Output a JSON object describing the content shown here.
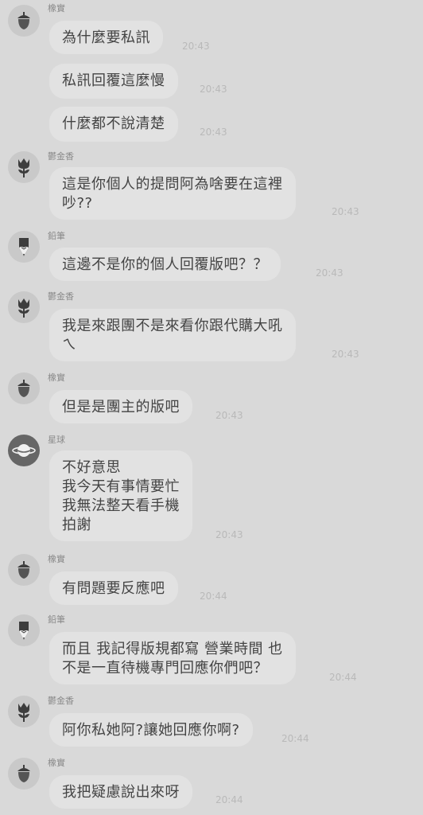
{
  "messages": [
    {
      "sender": "橡實",
      "text": "為什麼要私訊",
      "time": "20:43"
    },
    {
      "text": "私訊回覆這麼慢",
      "time": "20:43"
    },
    {
      "text": "什麼都不說清楚",
      "time": "20:43"
    },
    {
      "sender": "鬱金香",
      "text": "這是你個人的提問阿為啥要在這裡\n吵??",
      "time": "20:43"
    },
    {
      "sender": "鉛筆",
      "text": "這邊不是你的個人回覆版吧？？",
      "time": "20:43"
    },
    {
      "sender": "鬱金香",
      "text": "我是來跟團不是來看你跟代購大吼\nㄟ",
      "time": "20:43"
    },
    {
      "sender": "橡實",
      "text": "但是是團主的版吧",
      "time": "20:43"
    },
    {
      "sender": "星球",
      "text": "不好意思\n我今天有事情要忙\n我無法整天看手機\n拍謝",
      "time": "20:43"
    },
    {
      "sender": "橡實",
      "text": "有問題要反應吧",
      "time": "20:44"
    },
    {
      "sender": "鉛筆",
      "text": "而且 我記得版規都寫 營業時間 也\n不是一直待機專門回應你們吧？",
      "time": "20:44"
    },
    {
      "sender": "鬱金香",
      "text": "阿你私她阿?讓她回應你啊?",
      "time": "20:44"
    },
    {
      "sender": "橡實",
      "text": "我把疑慮說出來呀",
      "time": "20:44"
    }
  ],
  "icons": {
    "acorn": "acorn-icon",
    "tulip": "tulip-icon",
    "pencil": "pencil-icon",
    "planet": "planet-icon"
  }
}
